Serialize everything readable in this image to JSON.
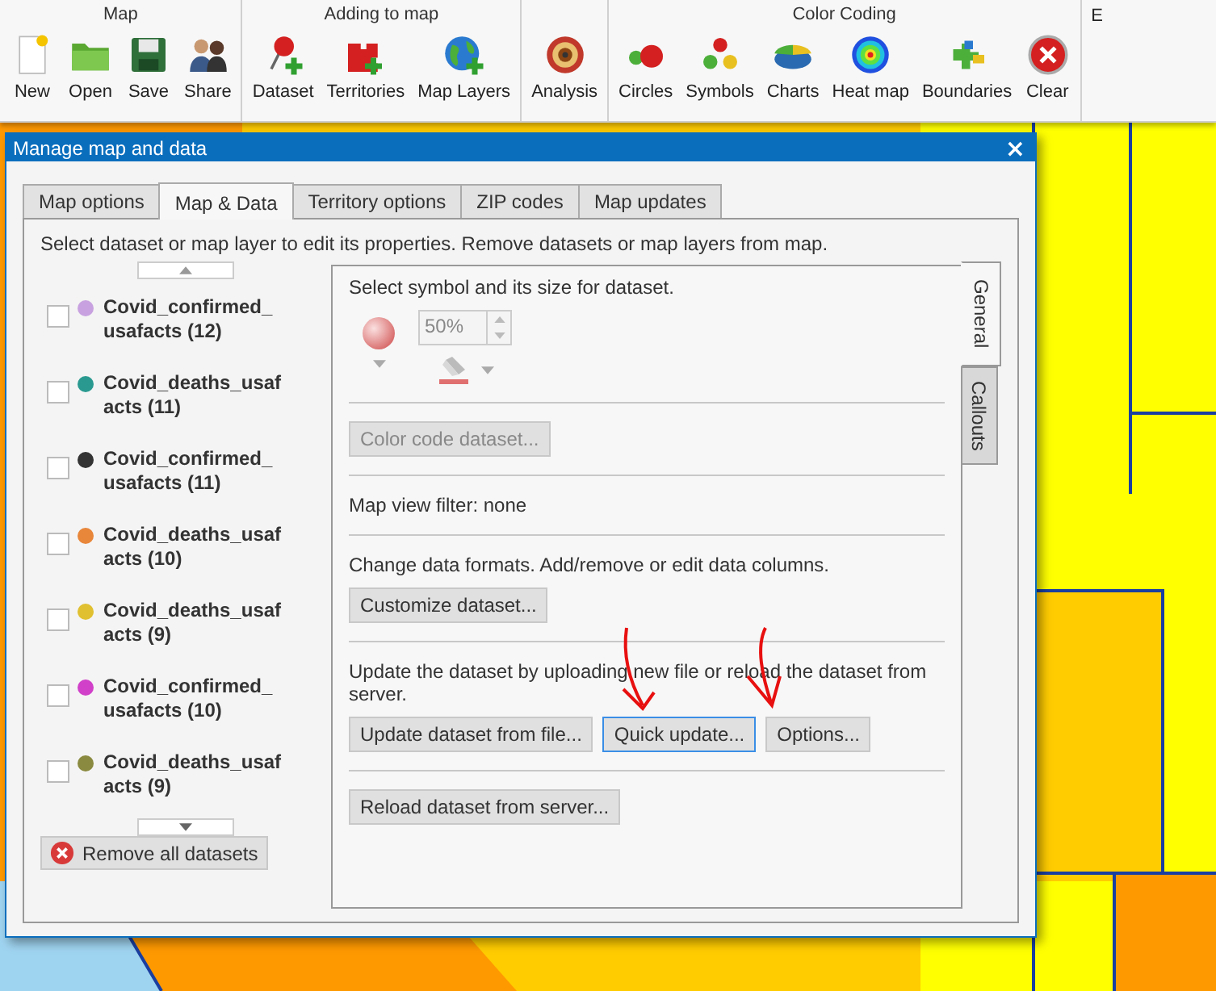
{
  "toolbar": {
    "groups": [
      {
        "title": "Map",
        "tools": [
          {
            "label": "New",
            "kind": "new"
          },
          {
            "label": "Open",
            "kind": "open"
          },
          {
            "label": "Save",
            "kind": "save"
          },
          {
            "label": "Share",
            "kind": "share"
          }
        ]
      },
      {
        "title": "Adding to map",
        "tools": [
          {
            "label": "Dataset",
            "kind": "dataset"
          },
          {
            "label": "Territories",
            "kind": "territories"
          },
          {
            "label": "Map Layers",
            "kind": "layers"
          }
        ]
      },
      {
        "tools": [
          {
            "label": "Analysis",
            "kind": "analysis"
          }
        ]
      },
      {
        "title": "Color Coding",
        "tools": [
          {
            "label": "Circles",
            "kind": "circles"
          },
          {
            "label": "Symbols",
            "kind": "symbols"
          },
          {
            "label": "Charts",
            "kind": "charts"
          },
          {
            "label": "Heat map",
            "kind": "heatmap"
          },
          {
            "label": "Boundaries",
            "kind": "boundaries"
          },
          {
            "label": "Clear",
            "kind": "clear"
          }
        ]
      },
      {
        "tools": [
          {
            "label": "E",
            "kind": "none"
          }
        ]
      }
    ]
  },
  "dialog": {
    "title": "Manage map and data",
    "close": "×",
    "tabs": [
      {
        "label": "Map options",
        "selected": false
      },
      {
        "label": "Map & Data",
        "selected": true
      },
      {
        "label": "Territory options",
        "selected": false
      },
      {
        "label": "ZIP codes",
        "selected": false
      },
      {
        "label": "Map updates",
        "selected": false
      }
    ],
    "instruction": "Select dataset or map layer to edit its properties. Remove datasets or map layers from map.",
    "datasets": [
      {
        "name": "Covid_confirmed_usafacts (12)",
        "color": "#c8a2e0",
        "checked": false
      },
      {
        "name": "Covid_deaths_usafacts (11)",
        "color": "#2a9a90",
        "checked": false
      },
      {
        "name": "Covid_confirmed_usafacts (11)",
        "color": "#333333",
        "checked": false
      },
      {
        "name": "Covid_deaths_usafacts (10)",
        "color": "#e8863a",
        "checked": false
      },
      {
        "name": "Covid_deaths_usafacts (9)",
        "color": "#e0c030",
        "checked": false
      },
      {
        "name": "Covid_confirmed_usafacts (10)",
        "color": "#d040c8",
        "checked": false
      },
      {
        "name": "Covid_deaths_usafacts (9)",
        "color": "#8a8a40",
        "checked": false
      }
    ],
    "remove_all": "Remove all datasets",
    "side_tabs": [
      {
        "label": "General",
        "selected": true
      },
      {
        "label": "Callouts",
        "selected": false
      }
    ],
    "symbol": {
      "label": "Select symbol and its size for dataset.",
      "size": "50%"
    },
    "sections": [
      {
        "buttons": [
          {
            "label": "Color code dataset...",
            "disabled": true,
            "focused": false
          }
        ]
      },
      {
        "text": "Map view filter: none"
      },
      {
        "text": "Change data formats. Add/remove or edit data columns.",
        "buttons": [
          {
            "label": "Customize dataset...",
            "disabled": false,
            "focused": false
          }
        ]
      },
      {
        "text": "Update the dataset by uploading new file or reload the dataset from server.",
        "buttons": [
          {
            "label": "Update dataset from file...",
            "disabled": false,
            "focused": false
          },
          {
            "label": "Quick update...",
            "disabled": false,
            "focused": true
          },
          {
            "label": "Options...",
            "disabled": false,
            "focused": false
          }
        ]
      },
      {
        "buttons": [
          {
            "label": "Reload dataset from server...",
            "disabled": false,
            "focused": false
          }
        ]
      }
    ]
  }
}
